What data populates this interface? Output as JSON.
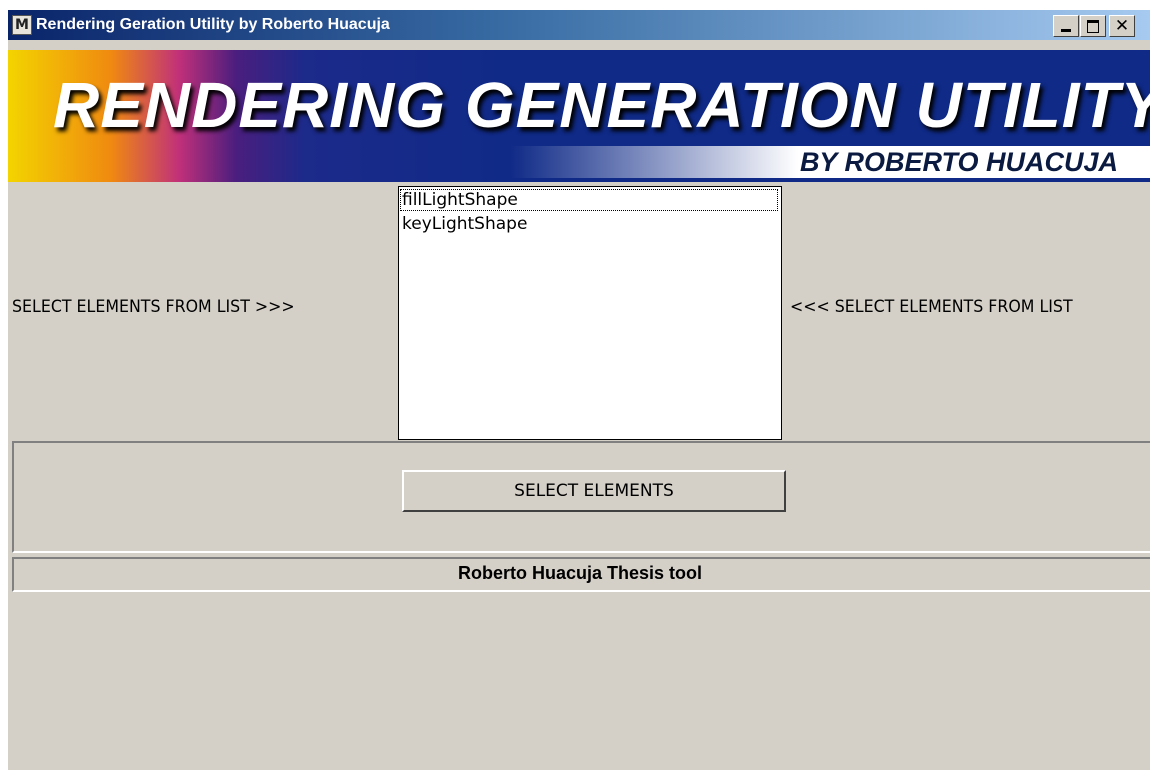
{
  "window": {
    "title": "Rendering Geration Utility by Roberto Huacuja",
    "app_icon_glyph": "M",
    "close_glyph": "✕"
  },
  "banner": {
    "title": "RENDERING GENERATION UTILITY",
    "subtitle": "BY ROBERTO HUACUJA"
  },
  "labels": {
    "left": "SELECT ELEMENTS FROM LIST >>>",
    "right": "<<< SELECT ELEMENTS FROM LIST"
  },
  "list": {
    "items": [
      "fillLightShape",
      "keyLightShape"
    ],
    "focused_index": 0
  },
  "buttons": {
    "select_label": "SELECT ELEMENTS"
  },
  "status": {
    "text": "Roberto Huacuja Thesis tool"
  },
  "colors": {
    "titlebar_start": "#0a246a",
    "titlebar_end": "#a6caf0",
    "window_bg": "#d4d0c8",
    "banner_blue": "#0f2a87"
  }
}
